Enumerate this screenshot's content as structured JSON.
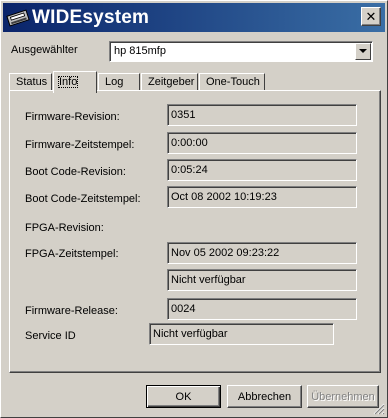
{
  "window": {
    "title": "WIDEsystem",
    "icon": "printer-icon",
    "close_glyph": "✕"
  },
  "selector": {
    "label": "Ausgewählter",
    "value": "hp 815mfp"
  },
  "tabs": [
    {
      "label": "Status",
      "active": false
    },
    {
      "label": "Info",
      "active": true
    },
    {
      "label": "Log",
      "active": false
    },
    {
      "label": "Zeitgeber",
      "active": false
    },
    {
      "label": "One-Touch",
      "active": false
    }
  ],
  "info": {
    "firmware_revision": {
      "label": "Firmware-Revision:",
      "value": "0351"
    },
    "firmware_timestamp": {
      "label": "Firmware-Zeitstempel:",
      "value": "0:00:00"
    },
    "bootcode_revision": {
      "label": "Boot Code-Revision:",
      "value": "0:05:24"
    },
    "bootcode_timestamp": {
      "label": "Boot Code-Zeitstempel:",
      "value": "Oct 08 2002 10:19:23"
    },
    "fpga_revision": {
      "label": "FPGA-Revision:"
    },
    "fpga_timestamp": {
      "label": "FPGA-Zeitstempel:",
      "value": "Nov 05 2002 09:23:22"
    },
    "fpga_extra": {
      "value": "Nicht verfügbar"
    },
    "firmware_release": {
      "label": "Firmware-Release:",
      "value": "0024"
    },
    "service_id": {
      "label": "Service ID",
      "value": "Nicht verfügbar"
    }
  },
  "buttons": {
    "ok": "OK",
    "cancel": "Abbrechen",
    "apply": "Übernehmen"
  }
}
